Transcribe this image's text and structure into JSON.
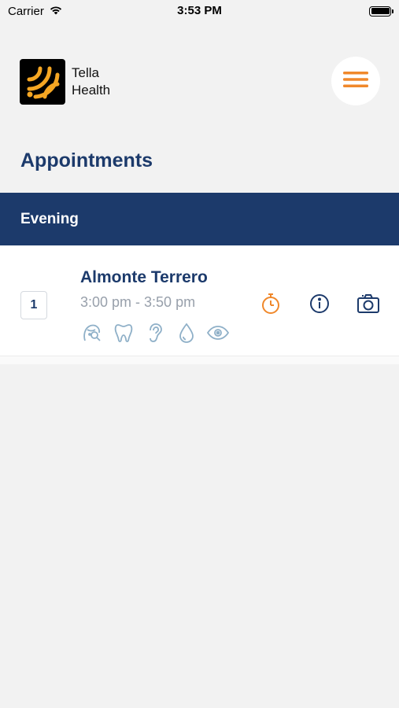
{
  "status_bar": {
    "carrier": "Carrier",
    "time": "3:53 PM",
    "battery_level": 1.0
  },
  "brand": {
    "line1": "Tella",
    "line2": "Health",
    "logo_color": "#f5a623"
  },
  "page": {
    "title": "Appointments"
  },
  "section": {
    "label": "Evening"
  },
  "appointments": [
    {
      "index": "1",
      "name": "Almonte Terrero",
      "time": "3:00 pm - 3:50 pm",
      "services": [
        "face-icon",
        "tooth-icon",
        "ear-icon",
        "drop-icon",
        "eye-icon"
      ],
      "actions": [
        "timer-icon",
        "info-icon",
        "camera-icon"
      ]
    }
  ],
  "colors": {
    "primary": "#1c3a6b",
    "accent": "#f0882b",
    "muted": "#98a0ab",
    "service_icon": "#8fb0c8"
  }
}
